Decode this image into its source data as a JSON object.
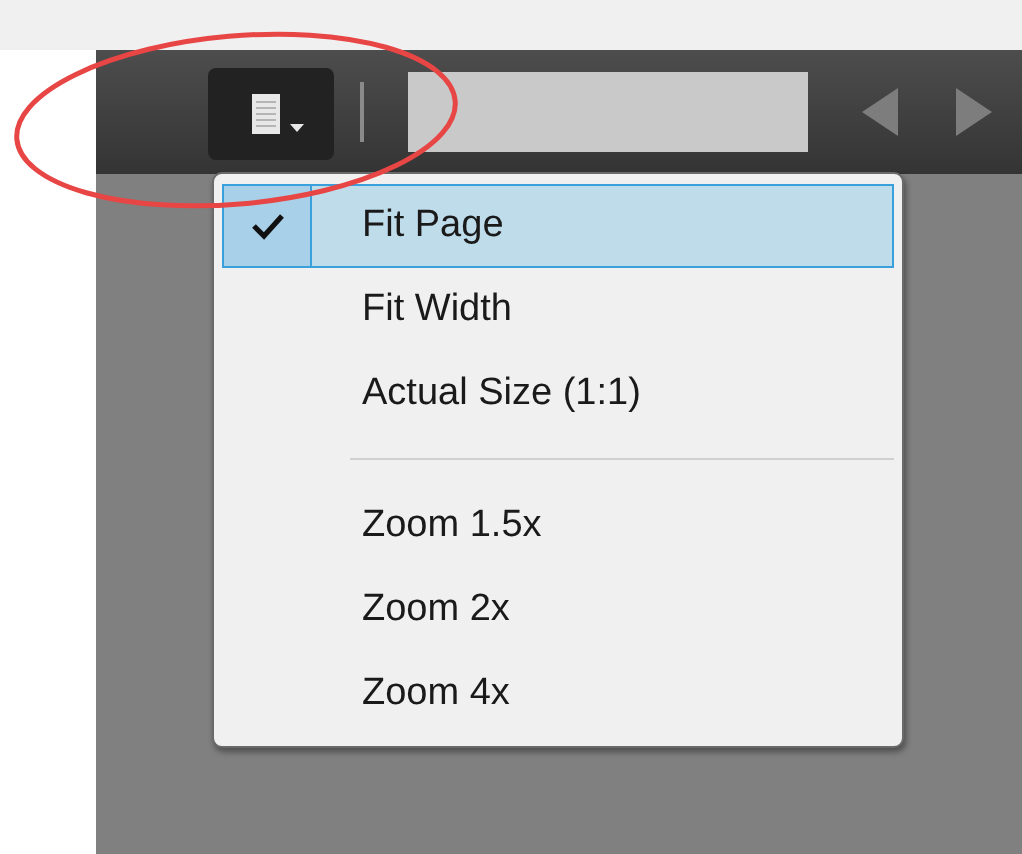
{
  "toolbar": {
    "view_button": {
      "kind": "dropdown"
    },
    "page_field": {
      "kind": "input"
    }
  },
  "menu": {
    "items": [
      {
        "kind": "item",
        "label": "Fit Page",
        "checked": true,
        "selected": true
      },
      {
        "kind": "item",
        "label": "Fit Width",
        "checked": false,
        "selected": false
      },
      {
        "kind": "item",
        "label": "Actual Size (1:1)",
        "checked": false,
        "selected": false
      },
      {
        "kind": "separator"
      },
      {
        "kind": "item",
        "label": "Zoom 1.5x",
        "checked": false,
        "selected": false
      },
      {
        "kind": "item",
        "label": "Zoom 2x",
        "checked": false,
        "selected": false
      },
      {
        "kind": "item",
        "label": "Zoom 4x",
        "checked": false,
        "selected": false
      }
    ]
  }
}
